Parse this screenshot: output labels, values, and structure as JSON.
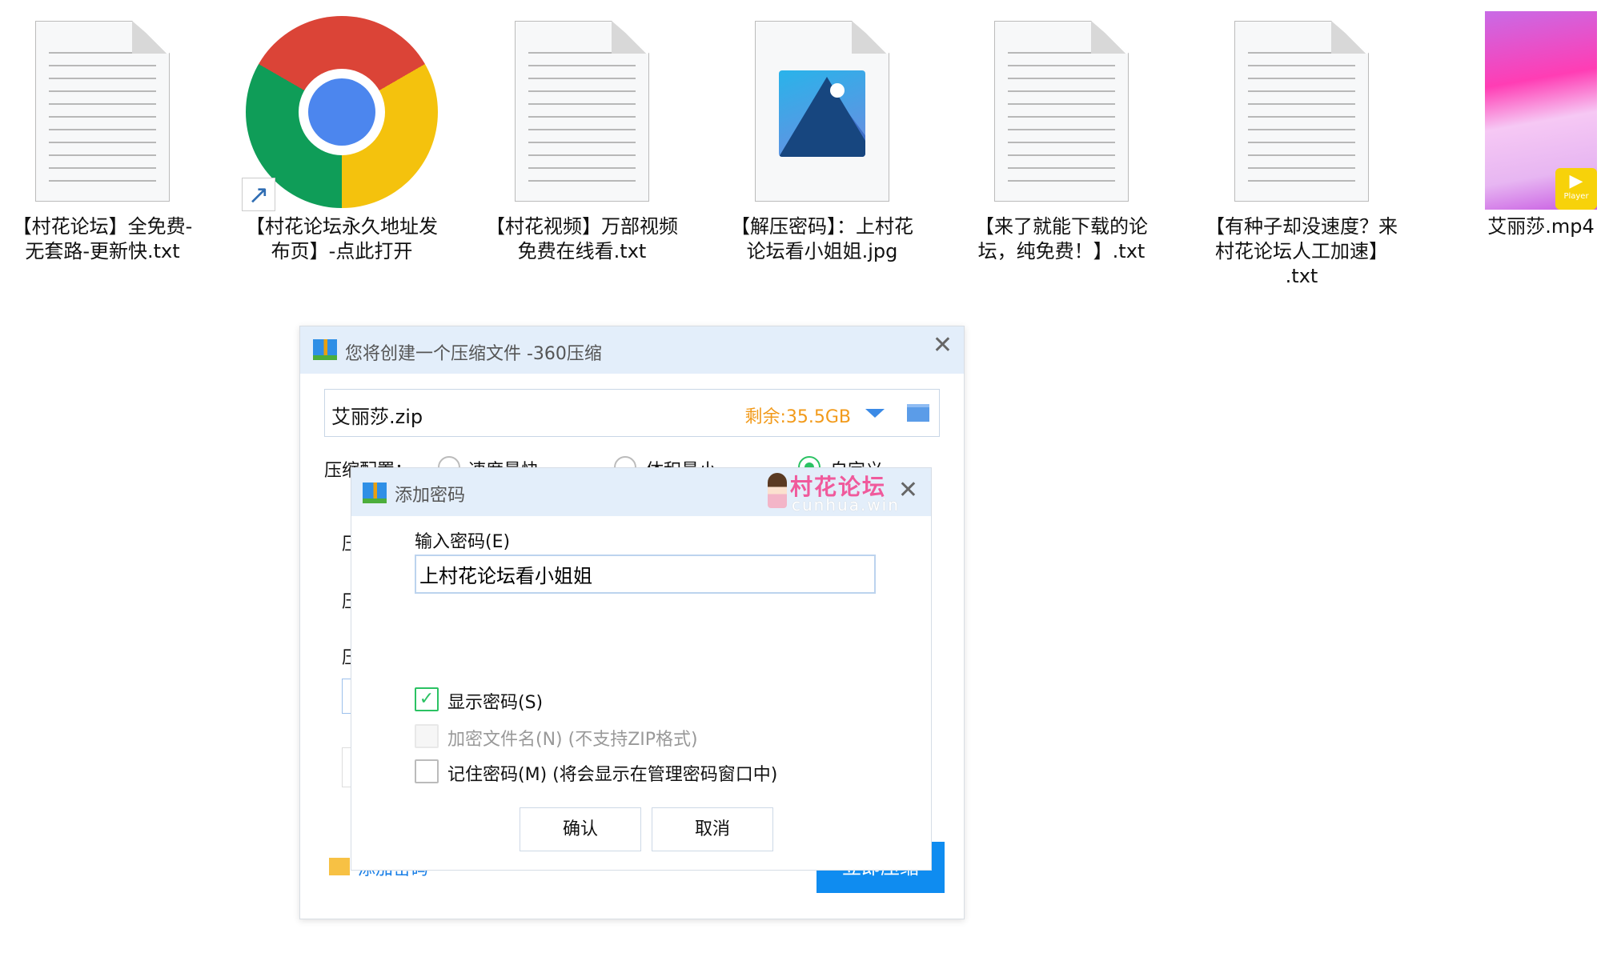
{
  "desktop": {
    "files": [
      {
        "name": "【村花论坛】全免费-无套路-更新快.txt",
        "line1": "【村花论坛】全免费-",
        "line2": "无套路-更新快.txt",
        "line3": "",
        "icon": "text-file-icon"
      },
      {
        "name": "【村花论坛永久地址发布页】-点此打开",
        "line1": "【村花论坛永久地址发",
        "line2": "布页】-点此打开",
        "line3": "",
        "icon": "chrome-shortcut-icon"
      },
      {
        "name": "【村花视频】万部视频免费在线看.txt",
        "line1": "【村花视频】万部视频",
        "line2": "免费在线看.txt",
        "line3": "",
        "icon": "text-file-icon"
      },
      {
        "name": "【解压密码】：上村花论坛看小姐姐.jpg",
        "line1": "【解压密码】：上村花",
        "line2": "论坛看小姐姐.jpg",
        "line3": "",
        "icon": "image-file-icon"
      },
      {
        "name": "【来了就能下载的论坛，纯免费！】.txt",
        "line1": "【来了就能下载的论",
        "line2": "坛，纯免费！】.txt",
        "line3": "",
        "icon": "text-file-icon"
      },
      {
        "name": "【有种子却没速度？来村花论坛人工加速】.txt",
        "line1": "【有种子却没速度？来",
        "line2": "村花论坛人工加速】",
        "line3": ".txt",
        "icon": "text-file-icon"
      },
      {
        "name": "艾丽莎.mp4",
        "line1": "艾丽莎.mp4",
        "line2": "",
        "line3": "",
        "icon": "video-thumbnail",
        "badge": "Player"
      }
    ]
  },
  "compress_dialog": {
    "title": "您将创建一个压缩文件 -360压缩",
    "filename": "艾丽莎.zip",
    "free_space": "剩余:35.5GB",
    "config_label": "压缩配置：",
    "options": [
      "速度最快",
      "体积最小",
      "自定义"
    ],
    "selected_option": "自定义",
    "row_label": "压",
    "add_password_link": "添加密码",
    "compress_button": "立即压缩",
    "accent": "#0f8cf0"
  },
  "password_dialog": {
    "title": "添加密码",
    "watermark": "村花论坛 cunhua.win",
    "watermark_cn": "村花论坛",
    "watermark_en": "cunhua.win",
    "input_label": "输入密码(E)",
    "password_value": "上村花论坛看小姐姐",
    "checkboxes": [
      {
        "label": "显示密码(S)",
        "checked": true,
        "disabled": false
      },
      {
        "label": "加密文件名(N) (不支持ZIP格式)",
        "checked": false,
        "disabled": true
      },
      {
        "label": "记住密码(M) (将会显示在管理密码窗口中)",
        "checked": false,
        "disabled": false
      }
    ],
    "ok_label": "确认",
    "cancel_label": "取消"
  }
}
